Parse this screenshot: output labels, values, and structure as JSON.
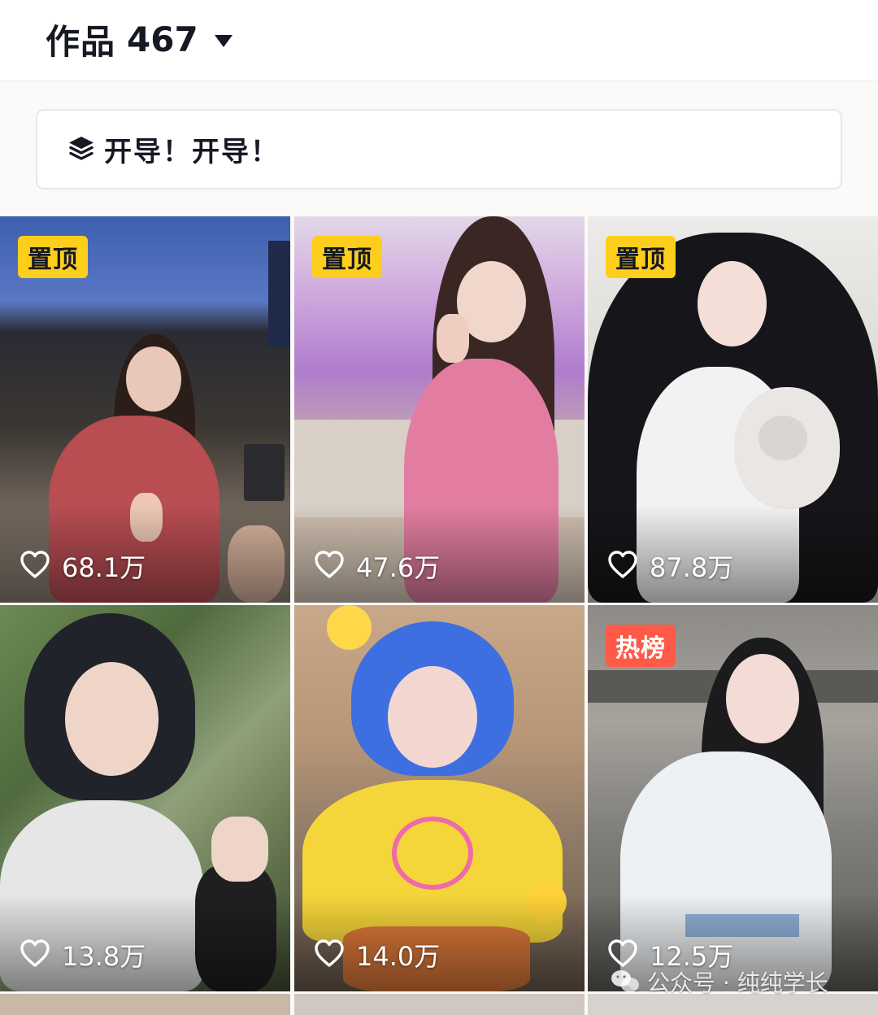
{
  "header": {
    "works_label": "作品",
    "works_count": "467"
  },
  "collection": {
    "icon": "layers-icon",
    "title": "开导！开导！"
  },
  "posts": [
    {
      "badge": "置顶",
      "badge_type": "pinned",
      "likes": "68.1万"
    },
    {
      "badge": "置顶",
      "badge_type": "pinned",
      "likes": "47.6万"
    },
    {
      "badge": "置顶",
      "badge_type": "pinned",
      "likes": "87.8万"
    },
    {
      "badge": "",
      "badge_type": "none",
      "likes": "13.8万"
    },
    {
      "badge": "",
      "badge_type": "none",
      "likes": "14.0万"
    },
    {
      "badge": "热榜",
      "badge_type": "hot",
      "likes": "12.5万"
    }
  ],
  "watermark": "公众号 · 纯纯学长",
  "colors": {
    "pinned_badge": "#fece1d",
    "hot_badge": "#fe5a47",
    "text_primary": "#161823"
  }
}
